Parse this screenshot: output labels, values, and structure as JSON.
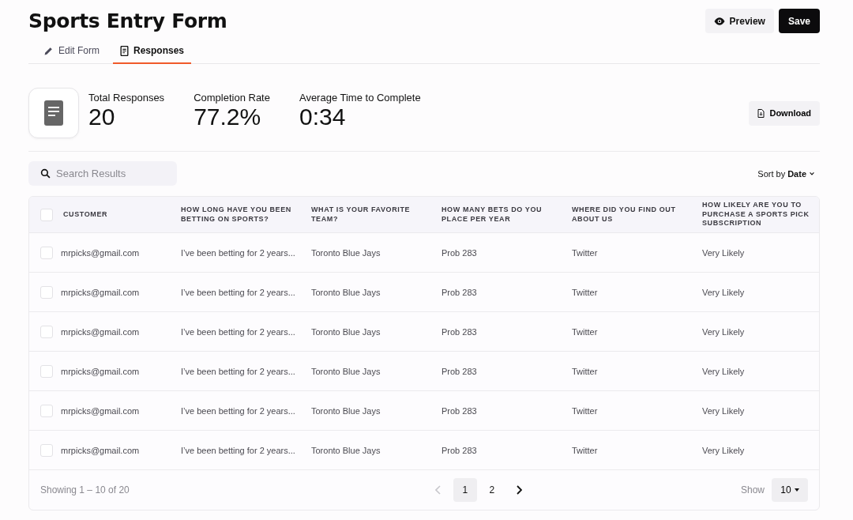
{
  "title": "Sports Entry Form",
  "header_buttons": [
    {
      "kind": "preview",
      "label": "Preview"
    },
    {
      "kind": "save",
      "label": "Save"
    }
  ],
  "tabs": [
    {
      "kind": "edit",
      "label": "Edit Form",
      "selected": false
    },
    {
      "kind": "responses",
      "label": "Responses",
      "selected": true
    }
  ],
  "stats": [
    {
      "label": "Total Responses",
      "value": "20"
    },
    {
      "label": "Completion Rate",
      "value": "77.2%"
    },
    {
      "label": "Average Time to Complete",
      "value": "0:34"
    }
  ],
  "download_button": "Download",
  "search": {
    "placeholder": "Search Results"
  },
  "sort": {
    "prefix": "Sort by",
    "value": "Date"
  },
  "table": {
    "select_all_checked": false,
    "columns": [
      "CUSTOMER",
      "HOW LONG HAVE YOU BEEN BETTING ON SPORTS?",
      "WHAT IS YOUR FAVORITE TEAM?",
      "HOW MANY BETS DO YOU PLACE PER YEAR",
      "WHERE DID YOU FIND OUT ABOUT US",
      "HOW LIKELY ARE YOU TO PURCHASE A SPORTS PICK SUBSCRIPTION"
    ],
    "rows": [
      {
        "checked": false,
        "cells": [
          "mrpicks@gmail.com",
          "I’ve been betting for 2 years...",
          "Toronto Blue Jays",
          "Prob 283",
          "Twitter",
          "Very Likely"
        ]
      },
      {
        "checked": false,
        "cells": [
          "mrpicks@gmail.com",
          "I’ve been betting for 2 years...",
          "Toronto Blue Jays",
          "Prob 283",
          "Twitter",
          "Very Likely"
        ]
      },
      {
        "checked": false,
        "cells": [
          "mrpicks@gmail.com",
          "I’ve been betting for 2 years...",
          "Toronto Blue Jays",
          "Prob 283",
          "Twitter",
          "Very Likely"
        ]
      },
      {
        "checked": false,
        "cells": [
          "mrpicks@gmail.com",
          "I’ve been betting for 2 years...",
          "Toronto Blue Jays",
          "Prob 283",
          "Twitter",
          "Very Likely"
        ]
      },
      {
        "checked": false,
        "cells": [
          "mrpicks@gmail.com",
          "I’ve been betting for 2 years...",
          "Toronto Blue Jays",
          "Prob 283",
          "Twitter",
          "Very Likely"
        ]
      },
      {
        "checked": false,
        "cells": [
          "mrpicks@gmail.com",
          "I’ve been betting for 2 years...",
          "Toronto Blue Jays",
          "Prob 283",
          "Twitter",
          "Very Likely"
        ]
      }
    ]
  },
  "pagination": {
    "summary": "Showing 1 – 10 of 20",
    "prev_disabled": true,
    "pages": [
      {
        "label": "1",
        "selected": true
      },
      {
        "label": "2",
        "selected": false
      }
    ],
    "show_label": "Show",
    "page_size": "10"
  }
}
